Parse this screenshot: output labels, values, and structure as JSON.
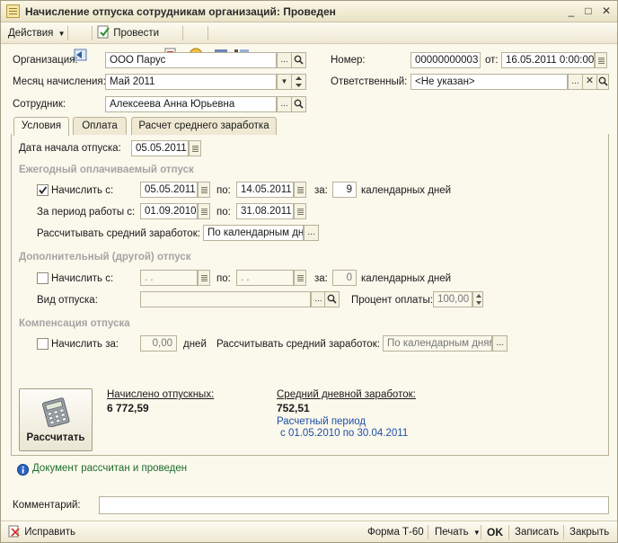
{
  "window": {
    "title": "Начисление отпуска сотрудникам организаций: Проведен",
    "minimize": "_",
    "maximize": "□",
    "close": "✕"
  },
  "toolbar": {
    "actions_label": "Действия",
    "post_label": "Провести"
  },
  "header": {
    "org_label": "Организация:",
    "org_value": "ООО Парус",
    "month_label": "Месяц начисления:",
    "month_value": "Май 2011",
    "employee_label": "Сотрудник:",
    "employee_value": "Алексеева Анна Юрьевна",
    "number_label": "Номер:",
    "number_value": "00000000003",
    "from_label": "от:",
    "date_value": "16.05.2011  0:00:00",
    "responsible_label": "Ответственный:",
    "responsible_value": "<Не указан>"
  },
  "tabs": [
    {
      "label": "Условия"
    },
    {
      "label": "Оплата"
    },
    {
      "label": "Расчет среднего заработка"
    }
  ],
  "conditions": {
    "start_date_label": "Дата начала отпуска:",
    "start_date_value": "05.05.2011",
    "annual_section": "Ежегодный оплачиваемый отпуск",
    "accrue_from_label": "Начислить с:",
    "annual_from": "05.05.2011",
    "to_label": "по:",
    "annual_to": "14.05.2011",
    "for_label": "за:",
    "annual_days": "9",
    "calendar_days_label": "календарных дней",
    "period_label": "За период работы с:",
    "period_from": "01.09.2010",
    "period_to": "31.08.2011",
    "avg_earnings_label": "Рассчитывать средний заработок:",
    "avg_earnings_value": "По календарным дня",
    "additional_section": "Дополнительный (другой) отпуск",
    "add_from": " .  .",
    "add_to": " .  .",
    "add_days": "0",
    "leave_type_label": "Вид отпуска:",
    "leave_type_value": "",
    "pay_percent_label": "Процент оплаты:",
    "pay_percent_value": "100,00",
    "compensation_section": "Компенсация отпуска",
    "comp_accrue_label": "Начислить за:",
    "comp_days_value": "0,00",
    "days_label": "дней",
    "comp_avg_label": "Рассчитывать средний заработок:",
    "comp_avg_value": "По календарным дням"
  },
  "results": {
    "calc_button": "Рассчитать",
    "accrued_label": "Начислено отпускных:",
    "accrued_value": "6 772,59",
    "avg_daily_label": "Средний дневной заработок:",
    "avg_daily_value": "752,51",
    "period_title": "Расчетный период",
    "period_range": "с 01.05.2010 по 30.04.2011"
  },
  "info": {
    "message": "Документ рассчитан и проведен"
  },
  "comment": {
    "label": "Комментарий:",
    "value": ""
  },
  "footer": {
    "fix_label": "Исправить",
    "form_label": "Форма Т-60",
    "print_label": "Печать",
    "ok_label": "OK",
    "save_label": "Записать",
    "close_label": "Закрыть"
  },
  "colors": {
    "background": "#fbf8ec",
    "section_gray": "#a4a4a4",
    "link_blue": "#1e4fa8",
    "info_green": "#1c6e2b"
  }
}
